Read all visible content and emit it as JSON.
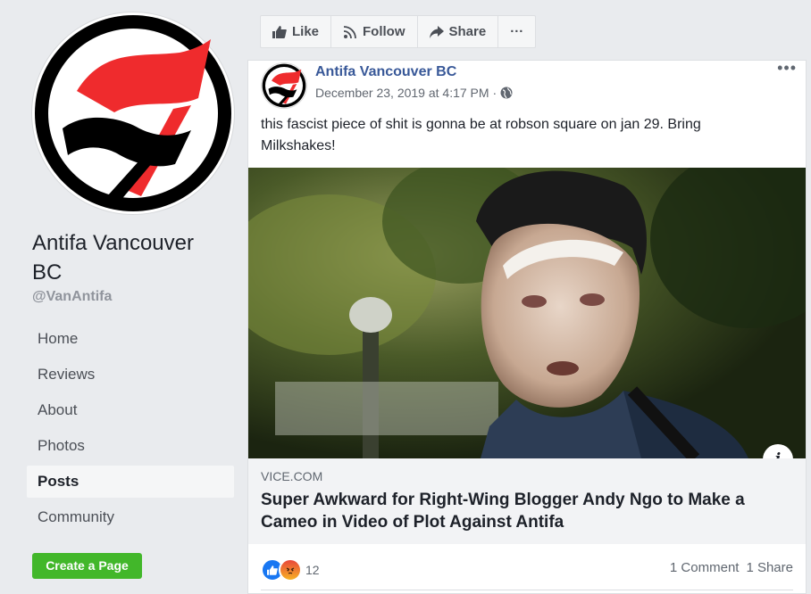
{
  "page": {
    "name": "Antifa Vancouver BC",
    "handle": "@VanAntifa"
  },
  "sidebar": {
    "items": [
      {
        "label": "Home"
      },
      {
        "label": "Reviews"
      },
      {
        "label": "About"
      },
      {
        "label": "Photos"
      },
      {
        "label": "Posts",
        "active": true
      },
      {
        "label": "Community"
      }
    ],
    "create_label": "Create a Page"
  },
  "actions": {
    "like": "Like",
    "follow": "Follow",
    "share": "Share",
    "more": "···"
  },
  "post": {
    "author": "Antifa Vancouver BC",
    "timestamp": "December 23, 2019 at 4:17 PM ·",
    "more": "•••",
    "text": "this fascist piece of shit is gonna be at robson square on jan 29. Bring Milkshakes!",
    "link": {
      "domain": "VICE.COM",
      "title": "Super Awkward for Right-Wing Blogger Andy Ngo to Make a Cameo in Video of Plot Against Antifa",
      "info": "i"
    },
    "reaction_count": "12",
    "comments": "1 Comment",
    "shares": "1 Share"
  },
  "colors": {
    "link_blue": "#385898",
    "create_green": "#42b72a",
    "flag_red": "#ef2b2d"
  },
  "icons": [
    "like-icon",
    "follow-icon",
    "share-icon",
    "globe-icon",
    "info-icon",
    "like-reaction-icon",
    "angry-reaction-icon"
  ]
}
